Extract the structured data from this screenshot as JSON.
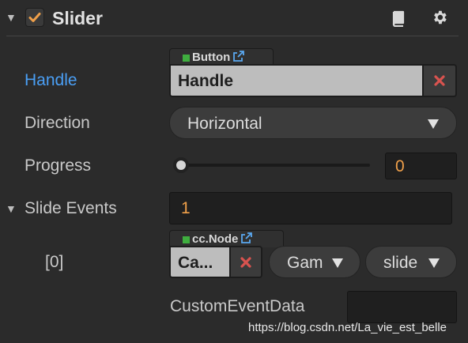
{
  "header": {
    "collapse_glyph": "▼",
    "enabled": true,
    "title": "Slider",
    "icons": [
      "book-icon",
      "gear-icon"
    ]
  },
  "props": {
    "handle": {
      "label": "Handle",
      "type_tag": "Button",
      "value": "Handle"
    },
    "direction": {
      "label": "Direction",
      "value": "Horizontal"
    },
    "progress": {
      "label": "Progress",
      "value": "0",
      "fraction": 0
    },
    "slide_events": {
      "collapse_glyph": "▼",
      "label": "Slide Events",
      "count": "1",
      "items": [
        {
          "index_label": "[0]",
          "type_tag": "cc.Node",
          "target": "Ca...",
          "component": "Gam",
          "handler": "slide",
          "custom_label": "CustomEventData",
          "custom_value": ""
        }
      ]
    }
  },
  "watermark": "https://blog.csdn.net/La_vie_est_belle",
  "colors": {
    "accent_orange": "#f0a04a",
    "label_blue": "#4a9ff5",
    "clear_red": "#d9534f",
    "tag_green": "#3fae3f",
    "background": "#2b2b2b"
  }
}
